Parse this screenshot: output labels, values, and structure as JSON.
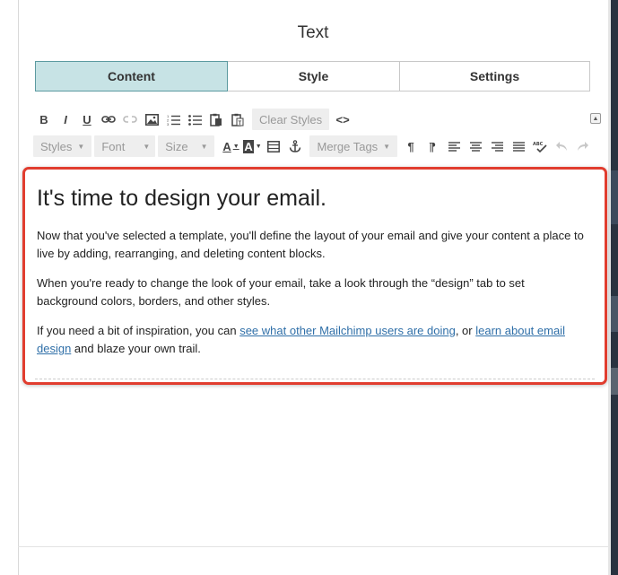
{
  "panel": {
    "title": "Text"
  },
  "tabs": [
    {
      "label": "Content",
      "active": true
    },
    {
      "label": "Style",
      "active": false
    },
    {
      "label": "Settings",
      "active": false
    }
  ],
  "toolbar": {
    "row1": {
      "bold": "B",
      "italic": "I",
      "underline": "U",
      "clear_styles": "Clear Styles",
      "source": "<>"
    },
    "row2": {
      "styles": "Styles",
      "font": "Font",
      "size": "Size",
      "text_color": "A",
      "bg_color": "A",
      "merge_tags": "Merge Tags",
      "pilcrow": "¶",
      "pilcrow_rtl": "¶"
    },
    "collapse_icon": "triangle-up-icon"
  },
  "content": {
    "heading": "It's time to design your email.",
    "p1": "Now that you've selected a template, you'll define the layout of your email and give your content a place to live by adding, rearranging, and deleting content blocks.",
    "p2": "When you're ready to change the look of your email, take a look through the “design” tab to set background colors, borders, and other styles.",
    "p3_before": "If you need a bit of inspiration, you can ",
    "p3_link1": "see what other Mailchimp users are doing",
    "p3_middle": ", or ",
    "p3_link2": "learn about email design",
    "p3_after": " and blaze your own trail."
  },
  "colors": {
    "active_tab_bg": "#c7e3e5",
    "highlight_border": "#e13d2f",
    "link": "#2f6fa8"
  }
}
